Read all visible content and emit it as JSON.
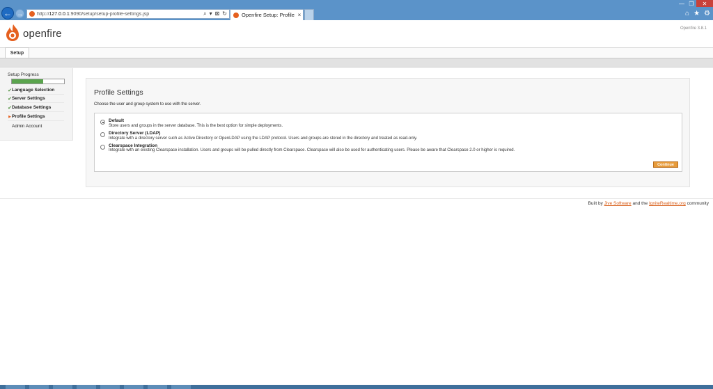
{
  "browser": {
    "url_prefix": "http://",
    "url_host": "127.0.0.1",
    "url_rest": ":9090/setup/setup-profile-settings.jsp",
    "tab_title": "Openfire Setup: Profile ...",
    "tab_close": "×",
    "back_glyph": "←",
    "forward_glyph": "→",
    "address_icons": [
      "⌕",
      "▾",
      "⊠",
      "↻"
    ],
    "window_controls": [
      "—",
      "❐",
      "✕"
    ],
    "toolbar_icons": [
      "⌂",
      "★",
      "⚙"
    ]
  },
  "header": {
    "logo_text": "openfire",
    "version": "Openfire 3.8.1",
    "tab_setup": "Setup"
  },
  "sidebar": {
    "title": "Setup Progress",
    "progress_fraction": 0.6,
    "progress_color": "#5aa44d",
    "steps": [
      {
        "label": "Language Selection",
        "state": "done",
        "mark": "✔"
      },
      {
        "label": "Server Settings",
        "state": "done",
        "mark": "✔"
      },
      {
        "label": "Database Settings",
        "state": "done",
        "mark": "✔"
      },
      {
        "label": "Profile Settings",
        "state": "current",
        "mark": "▶"
      },
      {
        "label": "Admin Account",
        "state": "pending",
        "mark": ""
      }
    ]
  },
  "main": {
    "title": "Profile Settings",
    "description": "Choose the user and group system to use with the server.",
    "options": [
      {
        "title": "Default",
        "description": "Store users and groups in the server database. This is the best option for simple deployments.",
        "checked": true
      },
      {
        "title": "Directory Server (LDAP)",
        "description": "Integrate with a directory server such as Active Directory or OpenLDAP using the LDAP protocol. Users and groups are stored in the directory and treated as read-only.",
        "checked": false
      },
      {
        "title": "Clearspace Integration",
        "description": "Integrate with an existing Clearspace installation. Users and groups will be pulled directly from Clearspace. Clearspace will also be used for authenticating users. Please be aware that Clearspace 2.0 or higher is required.",
        "checked": false
      }
    ],
    "continue_label": "Continue"
  },
  "footer": {
    "prefix": "Built by",
    "link1": "Jive Software",
    "middle": "and the",
    "link2": "IgniteRealtime.org",
    "suffix": "community"
  },
  "colors": {
    "chrome": "#5b93c9",
    "accent": "#e5601f",
    "button": "#e79b3a"
  }
}
